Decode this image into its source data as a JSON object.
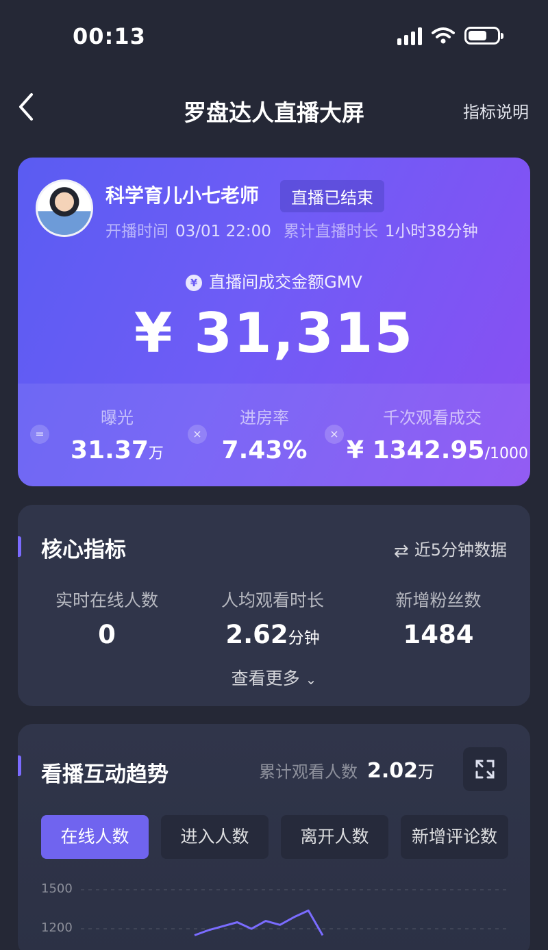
{
  "status_bar": {
    "time": "00:13"
  },
  "nav": {
    "title": "罗盘达人直播大屏",
    "right_link": "指标说明"
  },
  "live": {
    "streamer_name": "科学育儿小七老师",
    "status_badge": "直播已结束",
    "start_label": "开播时间",
    "start_value": "03/01 22:00",
    "duration_label": "累计直播时长",
    "duration_value": "1小时38分钟",
    "gmv_icon": "¥",
    "gmv_label": "直播间成交金额GMV",
    "gmv_value": "¥ 31,315",
    "stats": [
      {
        "label": "曝光",
        "value": "31.37",
        "unit": "万"
      },
      {
        "label": "进房率",
        "value": "7.43%",
        "unit": ""
      },
      {
        "label": "千次观看成交",
        "value": "¥ 1342.95",
        "unit": "/1000"
      }
    ],
    "operators": [
      "=",
      "×",
      "×"
    ]
  },
  "core": {
    "title": "核心指标",
    "update_note": "近5分钟数据",
    "metrics": [
      {
        "label": "实时在线人数",
        "value": "0",
        "unit": ""
      },
      {
        "label": "人均观看时长",
        "value": "2.62",
        "unit": "分钟"
      },
      {
        "label": "新增粉丝数",
        "value": "1484",
        "unit": ""
      }
    ],
    "more_label": "查看更多"
  },
  "trend": {
    "title": "看播互动趋势",
    "cum_label": "累计观看人数",
    "cum_value": "2.02",
    "cum_unit": "万",
    "tabs": [
      "在线人数",
      "进入人数",
      "离开人数",
      "新增评论数"
    ],
    "active_tab": 0
  },
  "chart_data": {
    "type": "line",
    "y_ticks": [
      "1500",
      "1200"
    ],
    "series": [
      {
        "values": [
          1150,
          1190,
          1220,
          1250,
          1200,
          1260,
          1230,
          1290,
          1340,
          1150
        ]
      }
    ],
    "line_color": "#7a6cff"
  }
}
